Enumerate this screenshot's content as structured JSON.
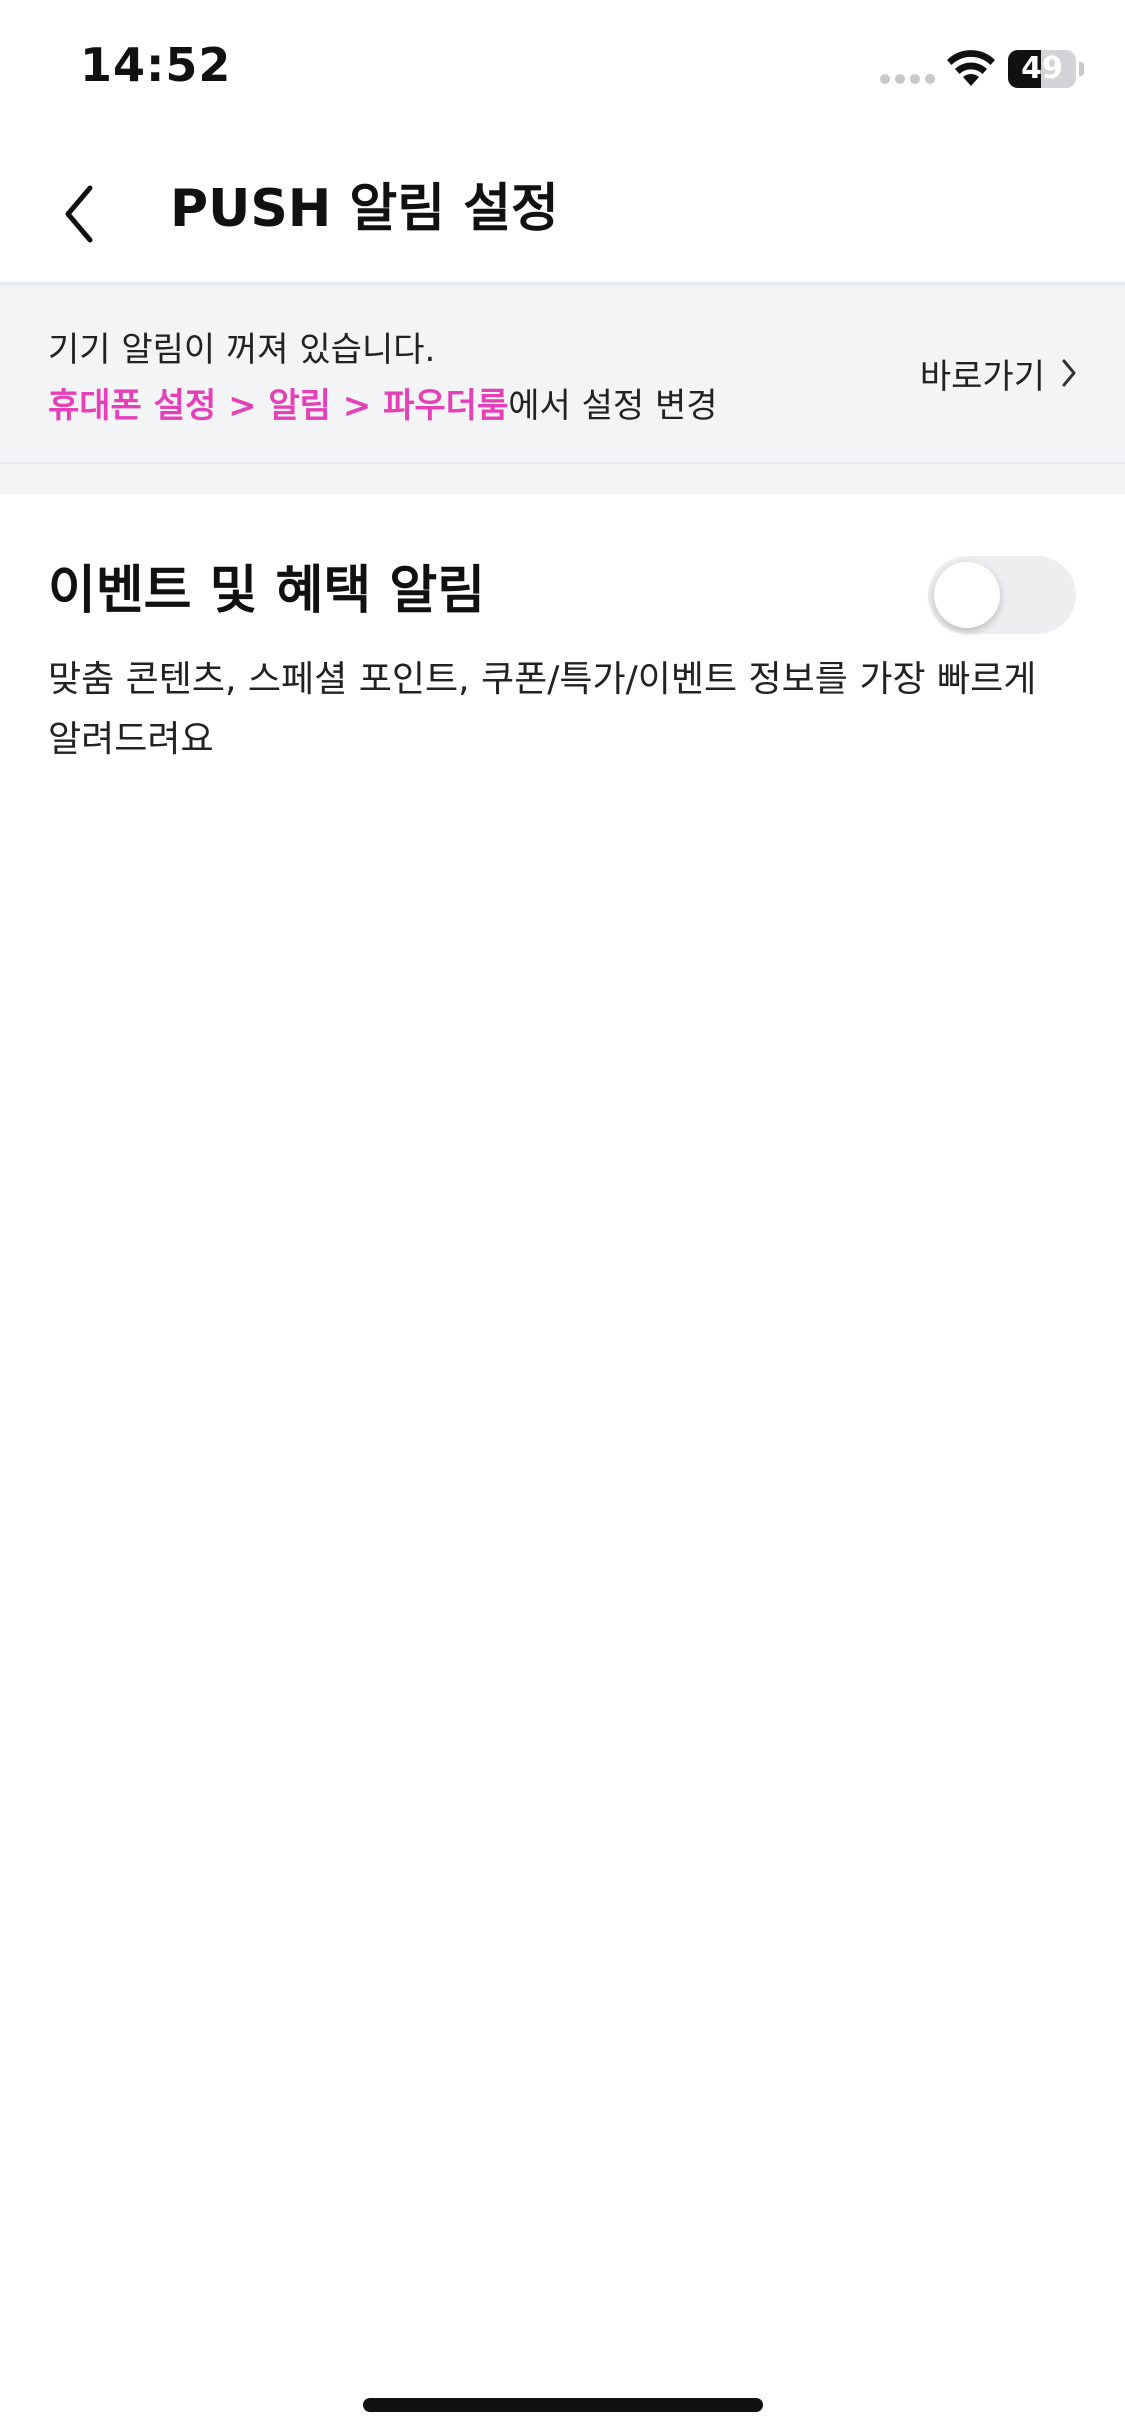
{
  "status_bar": {
    "time": "14:52",
    "battery_level": "49",
    "battery_fraction": 0.49,
    "icons": [
      "cellular-signal-icon",
      "wifi-icon",
      "battery-icon"
    ]
  },
  "nav": {
    "title": "PUSH 알림 설정",
    "back_icon": "chevron-left-icon"
  },
  "notice": {
    "line1": "기기 알림이 꺼져 있습니다.",
    "path": "휴대폰 설정 > 알림 > 파우더룸",
    "path_suffix": "에서 설정 변경",
    "shortcut_label": "바로가기",
    "shortcut_icon": "chevron-right-icon",
    "accent_color": "#e540b8"
  },
  "settings": [
    {
      "title": "이벤트 및 혜택 알림",
      "description": "맞춤 콘텐츠, 스페셜 포인트, 쿠폰/특가/이벤트 정보를 가장 빠르게 알려드려요",
      "enabled": false
    }
  ],
  "colors": {
    "banner_bg": "#f3f4f6",
    "toggle_off": "#eeeef0",
    "text": "#111111"
  }
}
